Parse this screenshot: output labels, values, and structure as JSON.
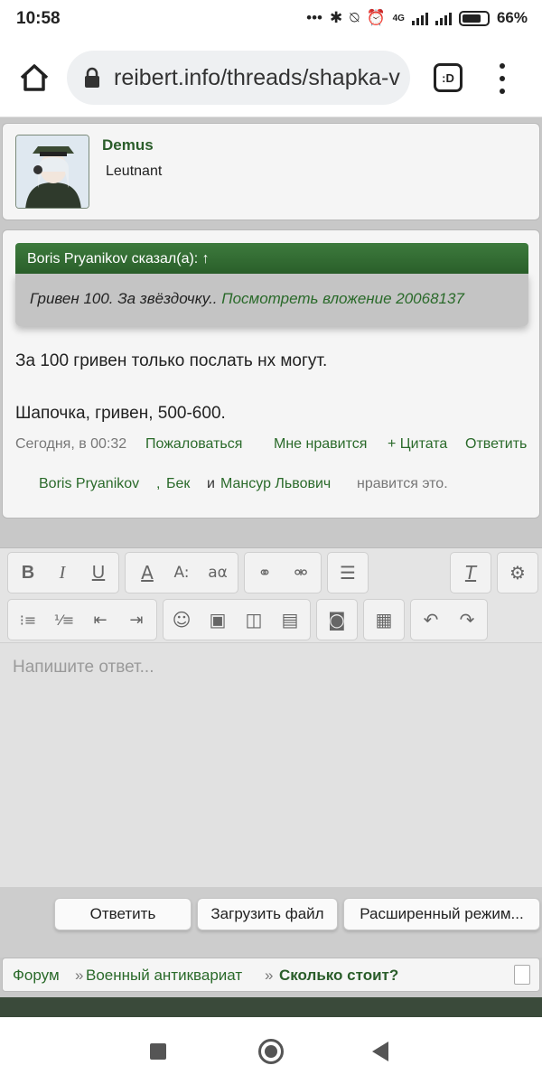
{
  "status_bar": {
    "time": "10:58",
    "network": "4G",
    "battery": "66%"
  },
  "browser": {
    "url": "reibert.info/threads/shapka-v",
    "tabs_label": ":D"
  },
  "user": {
    "name": "Demus",
    "rank": "Leutnant"
  },
  "post": {
    "quote_header": "Boris Pryanikov сказал(а): ↑",
    "quote_text": "Гривен 100. За звёздочку.. ",
    "quote_link": "Посмотреть вложение 20068137",
    "paragraphs": [
      "За 100 гривен только послать нх могут.",
      "Шапочка, гривен, 500-600."
    ],
    "date": "Сегодня, в 00:32",
    "actions": {
      "report": "Пожаловаться",
      "like": "Мне нравится",
      "quote": "+ Цитата",
      "reply": "Ответить"
    },
    "likes": {
      "user1": "Boris Pryanikov",
      "sep1": ", ",
      "user2": "Бек",
      "and": "и",
      "user3": "Мансур Львович",
      "suffix": "нравится это."
    }
  },
  "editor": {
    "placeholder": "Напишите ответ..."
  },
  "actions": {
    "reply": "Ответить",
    "upload": "Загрузить файл",
    "advanced": "Расширенный режим..."
  },
  "breadcrumb": {
    "forum": "Форум",
    "sep": "»",
    "category": "Военный антиквариат",
    "current": "Сколько стоит?"
  },
  "colors": {
    "accent_green": "#2a6a2a",
    "quote_header": "#3d7a3d"
  }
}
